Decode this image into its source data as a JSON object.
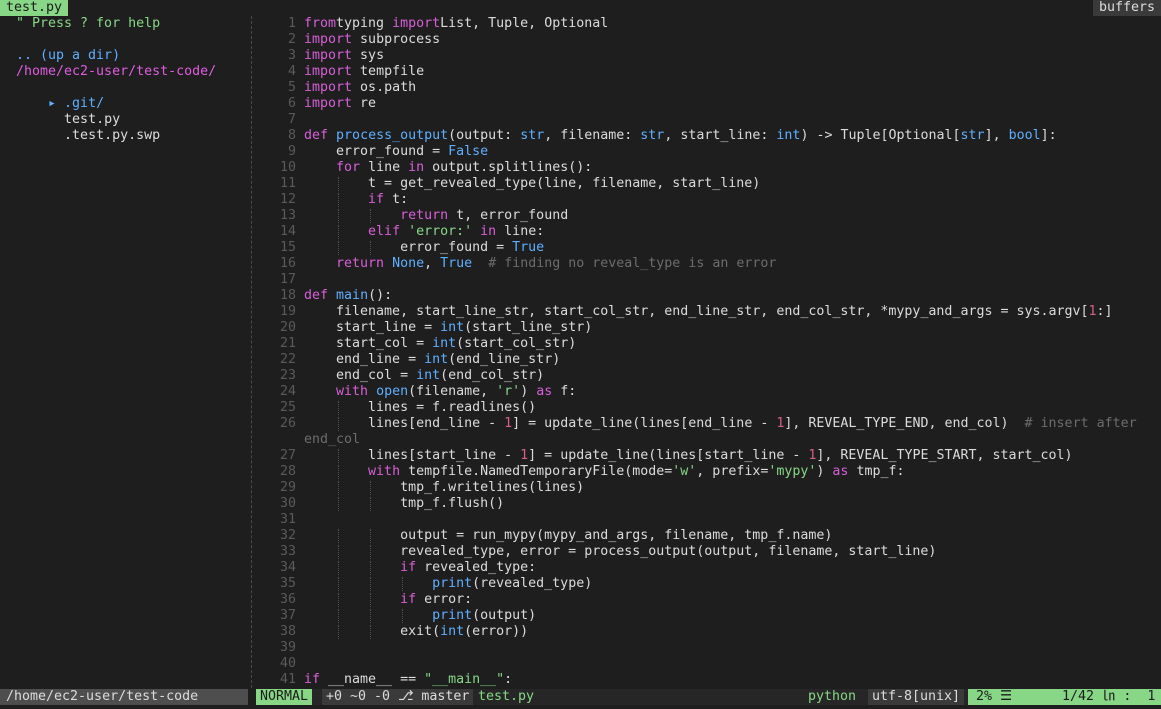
{
  "tabline": {
    "active_tab": "test.py",
    "right_label": "buffers"
  },
  "tree": {
    "help": "\" Press ? for help",
    "up_dir": ".. (up a dir)",
    "cwd": "/home/ec2-user/test-code/",
    "items": [
      {
        "marker": "▸ ",
        "name": ".git/"
      },
      {
        "marker": "  ",
        "name": "test.py"
      },
      {
        "marker": "  ",
        "name": ".test.py.swp"
      }
    ]
  },
  "editor": {
    "lines": [
      {
        "n": "1",
        "t": [
          [
            "kw",
            "from"
          ],
          [
            "",
            "typing "
          ],
          [
            "kw",
            "import"
          ],
          [
            "",
            "List, Tuple, Optional"
          ]
        ]
      },
      {
        "n": "2",
        "t": [
          [
            "kw",
            "import"
          ],
          [
            "",
            " subprocess"
          ]
        ]
      },
      {
        "n": "3",
        "t": [
          [
            "kw",
            "import"
          ],
          [
            "",
            " sys"
          ]
        ]
      },
      {
        "n": "4",
        "t": [
          [
            "kw",
            "import"
          ],
          [
            "",
            " tempfile"
          ]
        ]
      },
      {
        "n": "5",
        "t": [
          [
            "kw",
            "import"
          ],
          [
            "",
            " os.path"
          ]
        ]
      },
      {
        "n": "6",
        "t": [
          [
            "kw",
            "import"
          ],
          [
            "",
            " re"
          ]
        ]
      },
      {
        "n": "7",
        "t": []
      },
      {
        "n": "8",
        "t": [
          [
            "kw",
            "def"
          ],
          [
            "",
            " "
          ],
          [
            "bi",
            "process_output"
          ],
          [
            "",
            "(output: "
          ],
          [
            "bi",
            "str"
          ],
          [
            "",
            ", filename: "
          ],
          [
            "bi",
            "str"
          ],
          [
            "",
            ", start_line: "
          ],
          [
            "bi",
            "int"
          ],
          [
            "",
            ") -> Tuple[Optional["
          ],
          [
            "bi",
            "str"
          ],
          [
            "",
            "], "
          ],
          [
            "bi",
            "bool"
          ],
          [
            "",
            "]:"
          ]
        ]
      },
      {
        "n": "9",
        "t": [
          [
            "",
            "    error_found = "
          ],
          [
            "bi",
            "False"
          ]
        ]
      },
      {
        "n": "10",
        "t": [
          [
            "",
            "    "
          ],
          [
            "kw",
            "for"
          ],
          [
            "",
            " line "
          ],
          [
            "kw",
            "in"
          ],
          [
            "",
            " output.splitlines():"
          ]
        ]
      },
      {
        "n": "11",
        "t": [
          [
            "",
            "        t = get_revealed_type(line, filename, start_line)"
          ]
        ]
      },
      {
        "n": "12",
        "t": [
          [
            "",
            "        "
          ],
          [
            "kw",
            "if"
          ],
          [
            "",
            " t:"
          ]
        ]
      },
      {
        "n": "13",
        "t": [
          [
            "",
            "            "
          ],
          [
            "kw",
            "return"
          ],
          [
            "",
            " t, error_found"
          ]
        ]
      },
      {
        "n": "14",
        "t": [
          [
            "",
            "        "
          ],
          [
            "kw",
            "elif"
          ],
          [
            "",
            " "
          ],
          [
            "str",
            "'error:'"
          ],
          [
            "",
            " "
          ],
          [
            "kw",
            "in"
          ],
          [
            "",
            " line:"
          ]
        ]
      },
      {
        "n": "15",
        "t": [
          [
            "",
            "            error_found = "
          ],
          [
            "bi",
            "True"
          ]
        ]
      },
      {
        "n": "16",
        "t": [
          [
            "",
            "    "
          ],
          [
            "kw",
            "return"
          ],
          [
            "",
            " "
          ],
          [
            "bi",
            "None"
          ],
          [
            "",
            ", "
          ],
          [
            "bi",
            "True"
          ],
          [
            "",
            "  "
          ],
          [
            "cmt",
            "# finding no reveal_type is an error"
          ]
        ]
      },
      {
        "n": "17",
        "t": []
      },
      {
        "n": "18",
        "t": [
          [
            "kw",
            "def"
          ],
          [
            "",
            " "
          ],
          [
            "bi",
            "main"
          ],
          [
            "",
            "():"
          ]
        ]
      },
      {
        "n": "19",
        "t": [
          [
            "",
            "    filename, start_line_str, start_col_str, end_line_str, end_col_str, *mypy_and_args = sys.argv["
          ],
          [
            "num",
            "1"
          ],
          [
            "",
            ":]"
          ]
        ]
      },
      {
        "n": "20",
        "t": [
          [
            "",
            "    start_line = "
          ],
          [
            "bi",
            "int"
          ],
          [
            "",
            "(start_line_str)"
          ]
        ]
      },
      {
        "n": "21",
        "t": [
          [
            "",
            "    start_col = "
          ],
          [
            "bi",
            "int"
          ],
          [
            "",
            "(start_col_str)"
          ]
        ]
      },
      {
        "n": "22",
        "t": [
          [
            "",
            "    end_line = "
          ],
          [
            "bi",
            "int"
          ],
          [
            "",
            "(end_line_str)"
          ]
        ]
      },
      {
        "n": "23",
        "t": [
          [
            "",
            "    end_col = "
          ],
          [
            "bi",
            "int"
          ],
          [
            "",
            "(end_col_str)"
          ]
        ]
      },
      {
        "n": "24",
        "t": [
          [
            "",
            "    "
          ],
          [
            "kw",
            "with"
          ],
          [
            "",
            " "
          ],
          [
            "bi",
            "open"
          ],
          [
            "",
            "(filename, "
          ],
          [
            "str",
            "'r'"
          ],
          [
            "",
            ") "
          ],
          [
            "kw",
            "as"
          ],
          [
            "",
            " f:"
          ]
        ]
      },
      {
        "n": "25",
        "t": [
          [
            "",
            "        lines = f.readlines()"
          ]
        ]
      },
      {
        "n": "26",
        "t": [
          [
            "",
            "        lines[end_line - "
          ],
          [
            "num",
            "1"
          ],
          [
            "",
            "] = update_line(lines[end_line - "
          ],
          [
            "num",
            "1"
          ],
          [
            "",
            "], REVEAL_TYPE_END, end_col)  "
          ],
          [
            "cmt",
            "# insert after"
          ]
        ]
      },
      {
        "n": "",
        "t": [
          [
            "cmt",
            "end_col"
          ]
        ]
      },
      {
        "n": "27",
        "t": [
          [
            "",
            "        lines[start_line - "
          ],
          [
            "num",
            "1"
          ],
          [
            "",
            "] = update_line(lines[start_line - "
          ],
          [
            "num",
            "1"
          ],
          [
            "",
            "], REVEAL_TYPE_START, start_col)"
          ]
        ]
      },
      {
        "n": "28",
        "t": [
          [
            "",
            "        "
          ],
          [
            "kw",
            "with"
          ],
          [
            "",
            " tempfile.NamedTemporaryFile(mode="
          ],
          [
            "str",
            "'w'"
          ],
          [
            "",
            ", prefix="
          ],
          [
            "str",
            "'mypy'"
          ],
          [
            "",
            ") "
          ],
          [
            "kw",
            "as"
          ],
          [
            "",
            " tmp_f:"
          ]
        ]
      },
      {
        "n": "29",
        "t": [
          [
            "",
            "            tmp_f.writelines(lines)"
          ]
        ]
      },
      {
        "n": "30",
        "t": [
          [
            "",
            "            tmp_f.flush()"
          ]
        ]
      },
      {
        "n": "31",
        "t": []
      },
      {
        "n": "32",
        "t": [
          [
            "",
            "            output = run_mypy(mypy_and_args, filename, tmp_f.name)"
          ]
        ]
      },
      {
        "n": "33",
        "t": [
          [
            "",
            "            revealed_type, error = process_output(output, filename, start_line)"
          ]
        ]
      },
      {
        "n": "34",
        "t": [
          [
            "",
            "            "
          ],
          [
            "kw",
            "if"
          ],
          [
            "",
            " revealed_type:"
          ]
        ]
      },
      {
        "n": "35",
        "t": [
          [
            "",
            "                "
          ],
          [
            "bi",
            "print"
          ],
          [
            "",
            "(revealed_type)"
          ]
        ]
      },
      {
        "n": "36",
        "t": [
          [
            "",
            "            "
          ],
          [
            "kw",
            "if"
          ],
          [
            "",
            " error:"
          ]
        ]
      },
      {
        "n": "37",
        "t": [
          [
            "",
            "                "
          ],
          [
            "bi",
            "print"
          ],
          [
            "",
            "(output)"
          ]
        ]
      },
      {
        "n": "38",
        "t": [
          [
            "",
            "            exit("
          ],
          [
            "bi",
            "int"
          ],
          [
            "",
            "(error))"
          ]
        ]
      },
      {
        "n": "39",
        "t": []
      },
      {
        "n": "40",
        "t": []
      },
      {
        "n": "41",
        "t": [
          [
            "kw",
            "if"
          ],
          [
            "",
            " __name__ == "
          ],
          [
            "str",
            "\"__main__\""
          ],
          [
            "",
            ":"
          ]
        ]
      }
    ]
  },
  "statusline": {
    "tree_path": "/home/ec2-user/test-code",
    "mode": "NORMAL",
    "git": "+0 ~0 -0 ⎇ master",
    "filename": "test.py",
    "filetype": "python",
    "encoding": "utf-8[unix]",
    "percent": " 2% ☰ ",
    "position": " 1/42 ㏑ :  1 "
  },
  "colors": {
    "background": "#1e1e1e",
    "keyword": "#d75fd7",
    "builtin": "#5fafff",
    "string": "#87d787",
    "number": "#d75f87",
    "comment": "#6c6c6c",
    "mode_bg": "#87d787"
  }
}
